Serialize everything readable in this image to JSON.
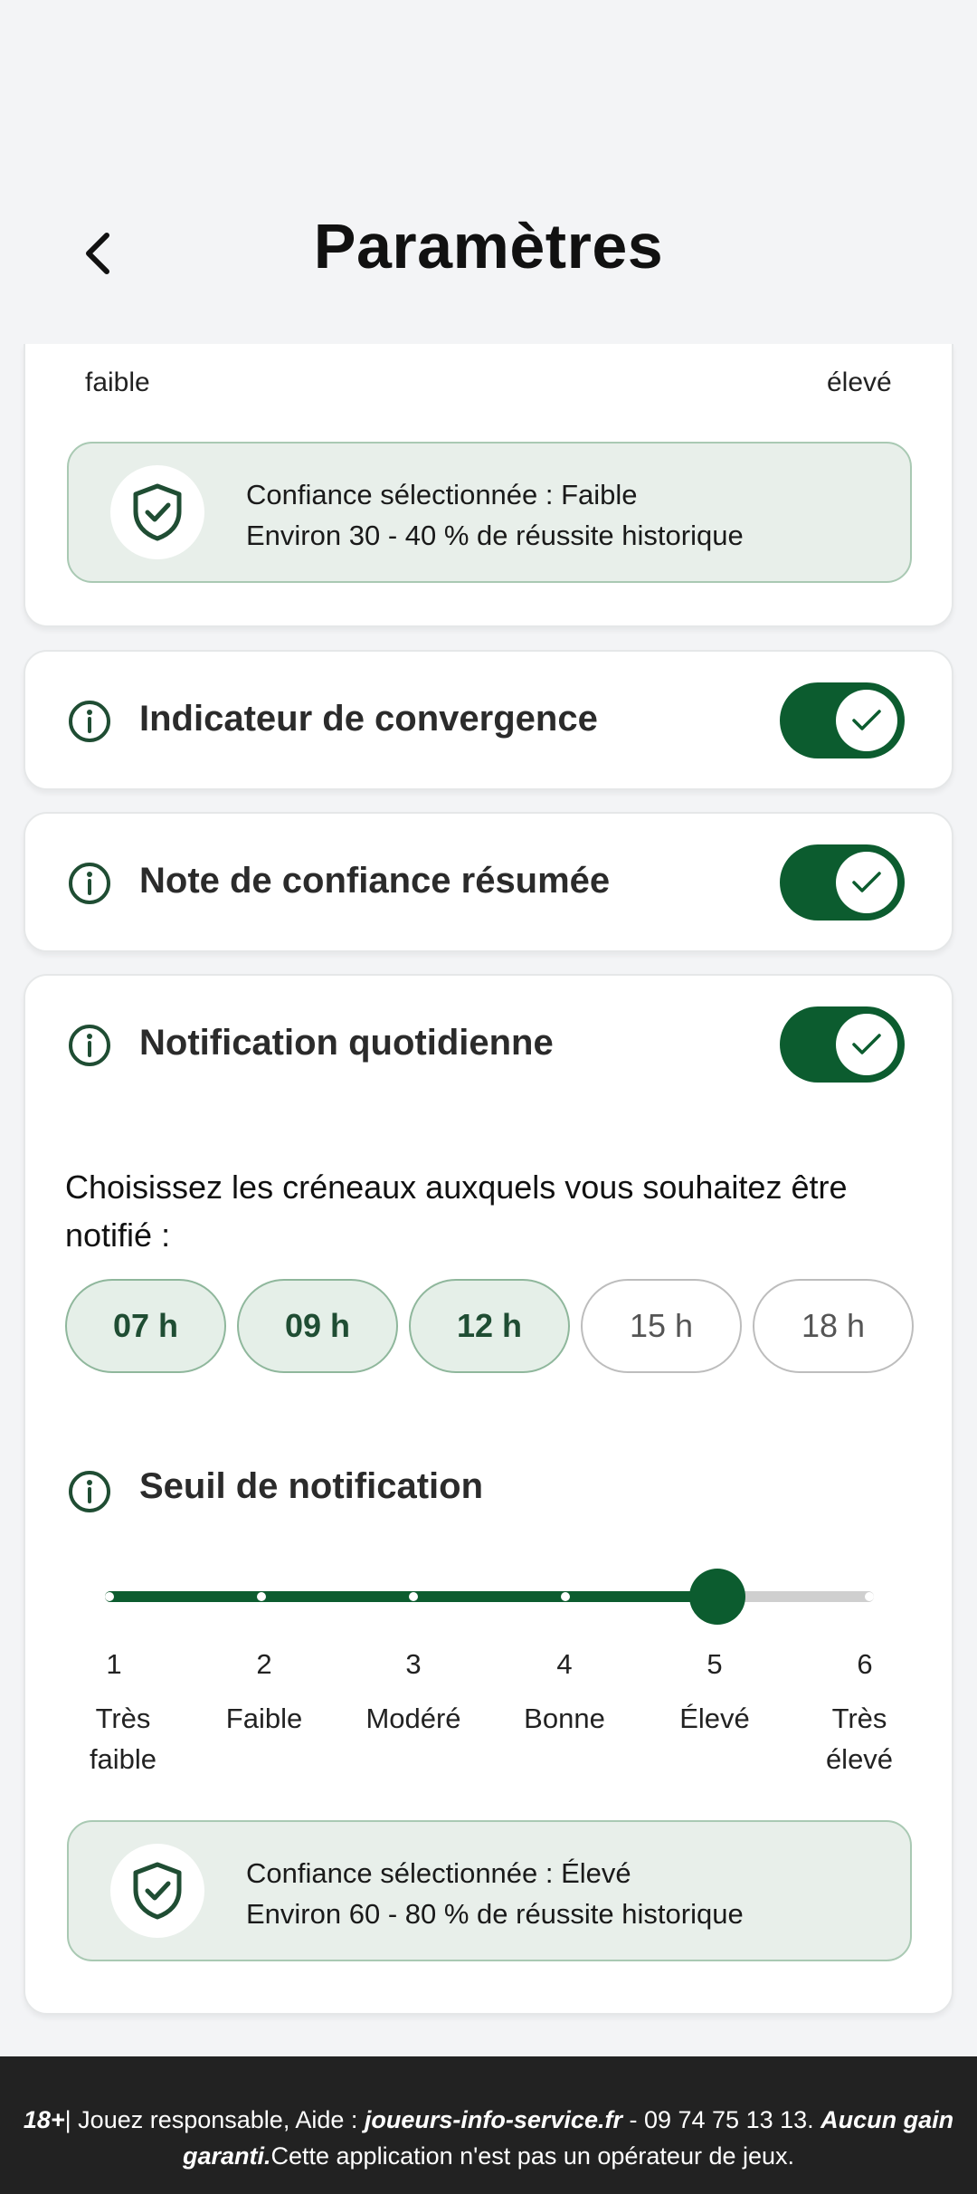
{
  "header": {
    "title": "Paramètres"
  },
  "top_card": {
    "label_left": "faible",
    "label_right": "élevé",
    "confidence_line1": "Confiance sélectionnée : Faible",
    "confidence_line2": "Environ 30 - 40 % de réussite historique"
  },
  "toggles": {
    "convergence": {
      "label": "Indicateur de convergence",
      "on": true
    },
    "note": {
      "label": "Note de confiance résumée",
      "on": true
    },
    "notification": {
      "label": "Notification quotidienne",
      "on": true
    }
  },
  "notification": {
    "choose_text": "Choisissez les créneaux auxquels vous souhaitez être notifié :",
    "slots": [
      {
        "label": "07 h",
        "selected": true
      },
      {
        "label": "09 h",
        "selected": true
      },
      {
        "label": "12 h",
        "selected": true
      },
      {
        "label": "15 h",
        "selected": false
      },
      {
        "label": "18 h",
        "selected": false
      }
    ],
    "threshold": {
      "label": "Seuil de notification",
      "value": 5,
      "min": 1,
      "max": 6,
      "ticks": [
        {
          "num": "1",
          "line1": "Très",
          "line2": "faible"
        },
        {
          "num": "2",
          "line1": "Faible",
          "line2": ""
        },
        {
          "num": "3",
          "line1": "Modéré",
          "line2": ""
        },
        {
          "num": "4",
          "line1": "Bonne",
          "line2": ""
        },
        {
          "num": "5",
          "line1": "Élevé",
          "line2": ""
        },
        {
          "num": "6",
          "line1": "Très",
          "line2": "élevé"
        }
      ]
    },
    "confidence_line1": "Confiance sélectionnée : Élevé",
    "confidence_line2": "Environ 60 - 80 % de réussite historique"
  },
  "footer": {
    "age": "18+",
    "text1": "| Jouez responsable, Aide : ",
    "site": "joueurs-info-service.fr",
    "text2": " - 09 74 75 13 13. ",
    "no_gain": "Aucun gain garanti.",
    "text3": "Cette application n'est pas un opérateur de jeux."
  },
  "colors": {
    "accent": "#0c5c2f",
    "chip_bg": "#e5efe8",
    "conf_bg": "#e8efea",
    "footer_bg": "#222222"
  }
}
